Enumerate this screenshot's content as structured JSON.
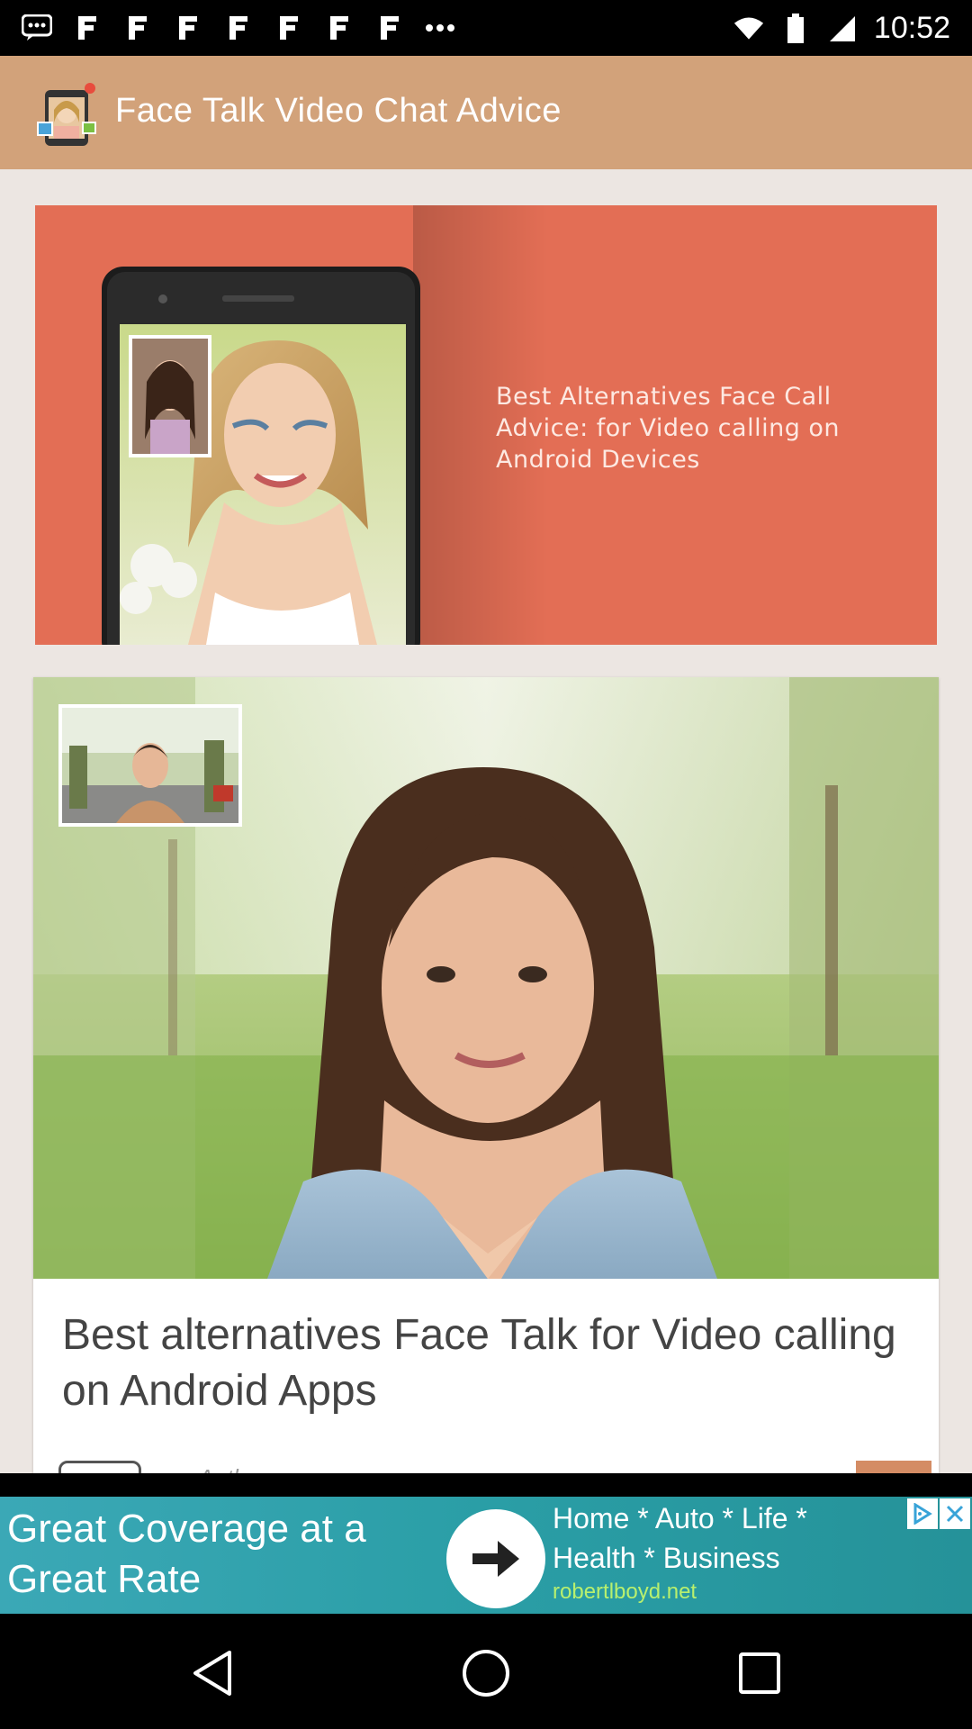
{
  "status_bar": {
    "time": "10:52",
    "notification_icons": [
      "messages-icon",
      "flipboard-icon",
      "flipboard-icon",
      "flipboard-icon",
      "flipboard-icon",
      "flipboard-icon",
      "flipboard-icon",
      "flipboard-icon",
      "more-dots-icon"
    ],
    "system_icons": [
      "wifi-icon",
      "battery-icon",
      "signal-icon"
    ]
  },
  "app_bar": {
    "title": "Face Talk Video Chat Advice",
    "icon": "app-logo-icon",
    "background": "#d2a27a"
  },
  "banner": {
    "text": "Best Alternatives Face Call Advice: for Video calling on Android Devices",
    "background": "#e36e55"
  },
  "article": {
    "title": "Best alternatives Face Talk for Video calling on Android Apps",
    "author_label": "Author"
  },
  "ad": {
    "headline": "Great Coverage at a Great Rate",
    "body_line1": "Home * Auto * Life *",
    "body_line2": "Health * Business",
    "domain": "robertlboyd.net",
    "background": "#2ea5ad"
  },
  "nav": {
    "buttons": [
      "back-icon",
      "home-icon",
      "recents-icon"
    ]
  }
}
